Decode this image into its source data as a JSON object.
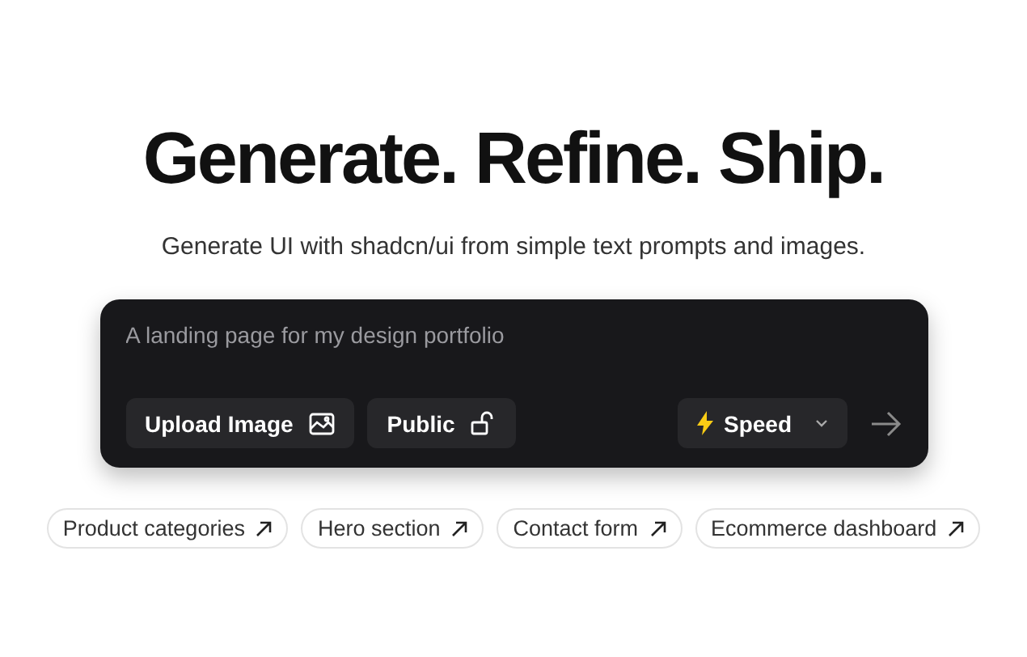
{
  "heading": "Generate. Refine. Ship.",
  "subtitle": "Generate UI with shadcn/ui from simple text prompts and images.",
  "prompt": {
    "placeholder": "A landing page for my design portfolio"
  },
  "buttons": [
    {
      "label": "Upload Image",
      "kind": "image"
    },
    {
      "label": "Public",
      "kind": "lock"
    }
  ],
  "model": {
    "label": "Speed"
  },
  "suggestions": [
    "Product categories",
    "Hero section",
    "Contact form",
    "Ecommerce dashboard"
  ]
}
